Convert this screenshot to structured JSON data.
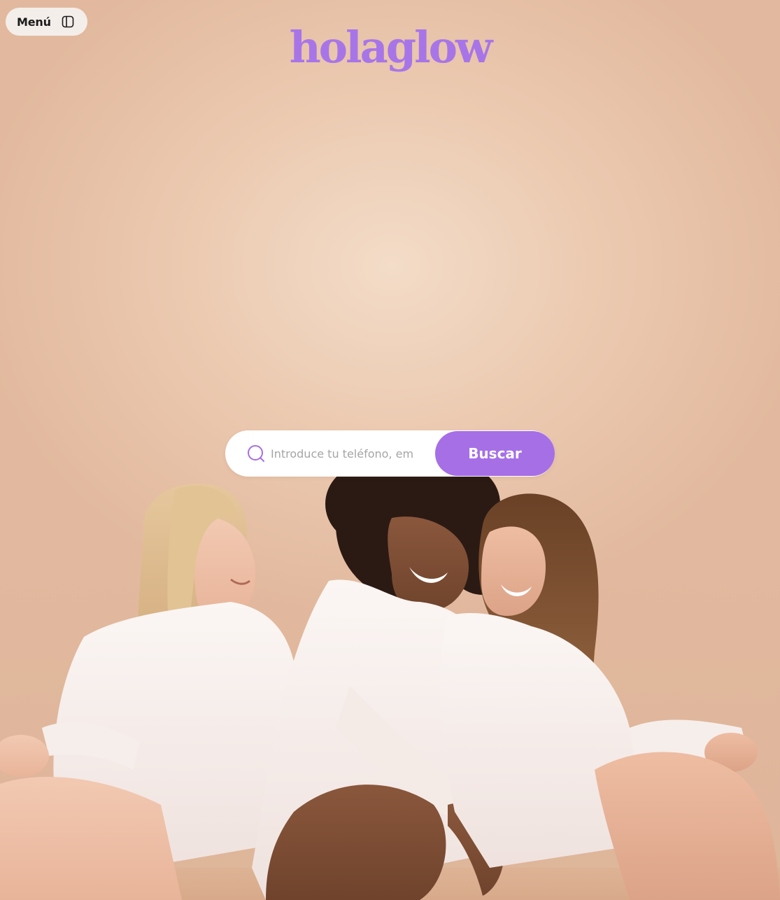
{
  "menu": {
    "label": "Menú",
    "icon": "sidebar-panel-icon"
  },
  "brand": {
    "logo_text": "holaglow",
    "accent": "#a66fe6"
  },
  "search": {
    "placeholder": "Introduce tu teléfono, em",
    "button_label": "Buscar",
    "icon": "search-icon"
  },
  "hero": {
    "image": "three-women-white-shirts-photo"
  }
}
